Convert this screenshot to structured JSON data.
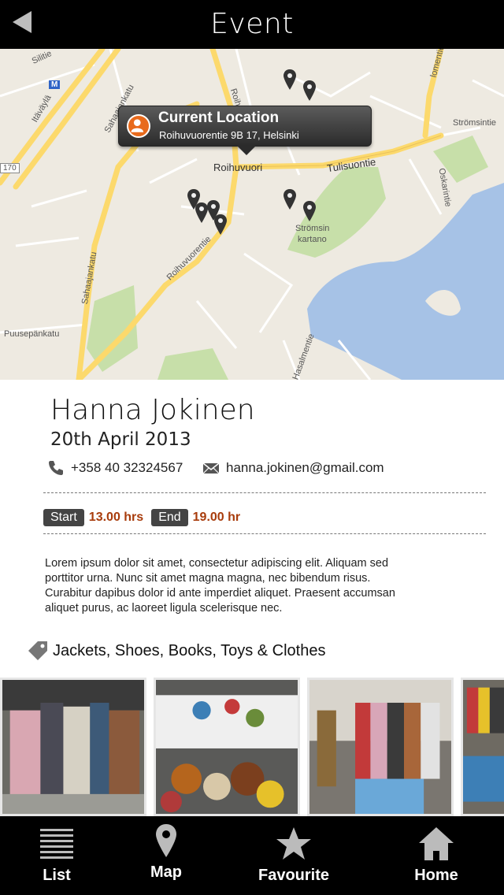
{
  "header": {
    "title": "Event",
    "back_icon": "back-arrow-icon"
  },
  "map": {
    "callout": {
      "title": "Current Location",
      "address": "Roihuvuorentie 9B 17, Helsinki"
    },
    "labels": {
      "itavayla": "Itäväylä",
      "sahaajankatu_top": "Sahaajankatu",
      "roihuvuorentie_top": "Roihuvuorentie",
      "roihuvuori": "Roihuvuori",
      "tulisuontie": "Tulisuontie",
      "stromsintie": "Strömsintie",
      "oskarintie": "Oskarintie",
      "stromsin": "Strömsin",
      "kartano": "kartano",
      "roihuvuorentie_bottom": "Roihuvuorentie",
      "sahaajankatu_left": "Sahaajankatu",
      "puusepankatu": "Puusepänkatu",
      "hasalmentie": "Hasalmentie",
      "road_170": "170",
      "metro": "M",
      "silitie": "Silitie",
      "lomentie": "lomentie"
    },
    "colors": {
      "land": "#eeeae1",
      "water": "#a6c2e6",
      "park": "#c7dfa9",
      "road": "#fcd96c"
    }
  },
  "event": {
    "name": "Hanna Jokinen",
    "date": "20th April 2013",
    "phone": "+358 40 32324567",
    "email": "hanna.jokinen@gmail.com",
    "start_label": "Start",
    "start_time": "13.00 hrs",
    "end_label": "End",
    "end_time": "19.00 hr",
    "description": "Lorem ipsum dolor sit amet, consectetur adipiscing elit. Aliquam sed porttitor urna. Nunc sit amet magna magna, nec bibendum risus. Curabitur dapibus dolor id ante imperdiet aliquet. Praesent accumsan aliquet purus, ac laoreet ligula scelerisque nec.",
    "tags": "Jackets, Shoes, Books, Toys & Clothes",
    "accent_color": "#a83c0c"
  },
  "tabbar": {
    "items": [
      {
        "label": "List",
        "icon": "list-icon"
      },
      {
        "label": "Map",
        "icon": "map-pin-icon"
      },
      {
        "label": "Favourite",
        "icon": "star-icon"
      },
      {
        "label": "Home",
        "icon": "home-icon"
      }
    ]
  }
}
